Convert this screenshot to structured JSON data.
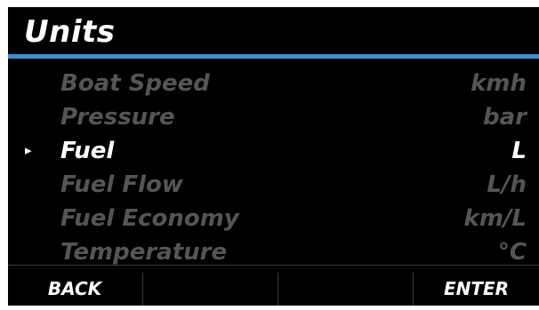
{
  "title": "Units",
  "menu": {
    "pointer": "▸",
    "items": [
      {
        "label": "Boat Speed",
        "value": "kmh",
        "selected": false
      },
      {
        "label": "Pressure",
        "value": "bar",
        "selected": false
      },
      {
        "label": "Fuel",
        "value": "L",
        "selected": true
      },
      {
        "label": "Fuel Flow",
        "value": "L/h",
        "selected": false
      },
      {
        "label": "Fuel Economy",
        "value": "km/L",
        "selected": false
      },
      {
        "label": "Temperature",
        "value": "°C",
        "selected": false
      }
    ]
  },
  "softkeys": {
    "back": "BACK",
    "key2": "",
    "key3": "",
    "enter": "ENTER"
  },
  "colors": {
    "background": "#000000",
    "accent": "#3a8fd8",
    "text_active": "#ffffff",
    "text_inactive": "#555555"
  }
}
